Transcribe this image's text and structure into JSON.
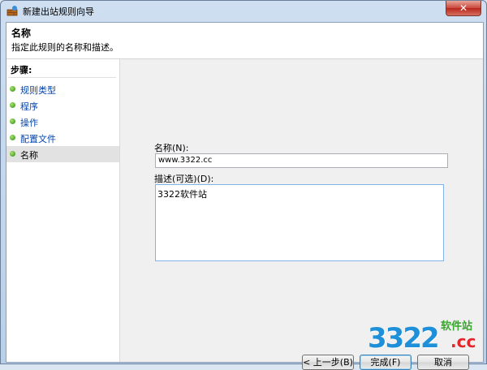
{
  "window": {
    "title": "新建出站规则向导",
    "close_glyph": "✕",
    "icon": "firewall-wizard-icon"
  },
  "header": {
    "title": "名称",
    "subtitle": "指定此规则的名称和描述。"
  },
  "sidebar": {
    "heading": "步骤:",
    "steps": [
      {
        "label": "规则类型",
        "current": false
      },
      {
        "label": "程序",
        "current": false
      },
      {
        "label": "操作",
        "current": false
      },
      {
        "label": "配置文件",
        "current": false
      },
      {
        "label": "名称",
        "current": true
      }
    ]
  },
  "form": {
    "name_label": "名称(N):",
    "name_value": "www.3322.cc",
    "desc_label": "描述(可选)(D):",
    "desc_value": "3322软件站"
  },
  "buttons": {
    "back": "< 上一步(B)",
    "finish": "完成(F)",
    "cancel": "取消"
  },
  "watermark": {
    "big": "3322",
    "cc": ".cc",
    "site": "软件站"
  },
  "colors": {
    "link": "#0645ad",
    "accent": "#1e8fd9",
    "watermark_red": "#e3262b",
    "watermark_green": "#3aa52f"
  }
}
